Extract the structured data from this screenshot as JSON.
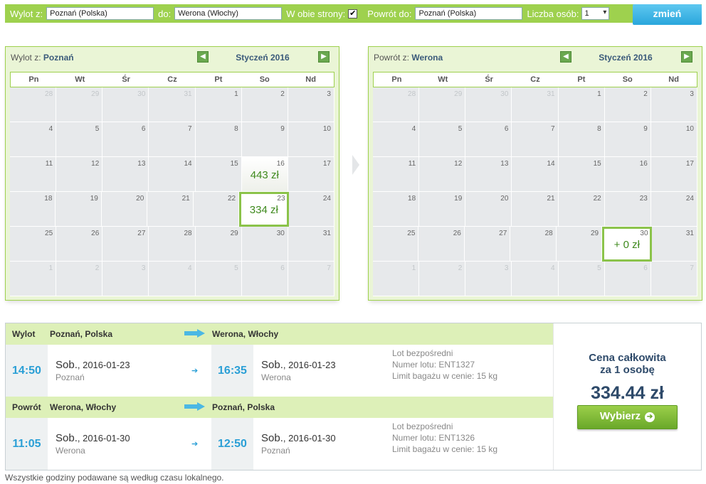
{
  "search": {
    "from_label": "Wylot z:",
    "from_value": "Poznań (Polska)",
    "to_label": "do:",
    "to_value": "Werona (Włochy)",
    "roundtrip_label": "W obie strony:",
    "roundtrip_checked": "✔",
    "return_label": "Powrót do:",
    "return_value": "Poznań (Polska)",
    "persons_label": "Liczba osób:",
    "persons_value": "1",
    "submit_label": "zmień"
  },
  "calendars": [
    {
      "route_prefix": "Wylot z: ",
      "route_city": "Poznań",
      "month": "Styczeń 2016",
      "weekdays": [
        "Pn",
        "Wt",
        "Śr",
        "Cz",
        "Pt",
        "So",
        "Nd"
      ],
      "weeks": [
        [
          {
            "n": "28",
            "o": true
          },
          {
            "n": "29",
            "o": true
          },
          {
            "n": "30",
            "o": true
          },
          {
            "n": "31",
            "o": true
          },
          {
            "n": "1"
          },
          {
            "n": "2"
          },
          {
            "n": "3"
          }
        ],
        [
          {
            "n": "4"
          },
          {
            "n": "5"
          },
          {
            "n": "6"
          },
          {
            "n": "7"
          },
          {
            "n": "8"
          },
          {
            "n": "9"
          },
          {
            "n": "10"
          }
        ],
        [
          {
            "n": "11"
          },
          {
            "n": "12"
          },
          {
            "n": "13"
          },
          {
            "n": "14"
          },
          {
            "n": "15"
          },
          {
            "n": "16",
            "p": "443 zł"
          },
          {
            "n": "17"
          }
        ],
        [
          {
            "n": "18"
          },
          {
            "n": "19"
          },
          {
            "n": "20"
          },
          {
            "n": "21"
          },
          {
            "n": "22"
          },
          {
            "n": "23",
            "p": "334 zł",
            "s": true
          },
          {
            "n": "24"
          }
        ],
        [
          {
            "n": "25"
          },
          {
            "n": "26"
          },
          {
            "n": "27"
          },
          {
            "n": "28"
          },
          {
            "n": "29"
          },
          {
            "n": "30"
          },
          {
            "n": "31"
          }
        ],
        [
          {
            "n": "1",
            "o": true
          },
          {
            "n": "2",
            "o": true
          },
          {
            "n": "3",
            "o": true
          },
          {
            "n": "4",
            "o": true
          },
          {
            "n": "5",
            "o": true
          },
          {
            "n": "6",
            "o": true
          },
          {
            "n": "7",
            "o": true
          }
        ]
      ]
    },
    {
      "route_prefix": "Powrót z: ",
      "route_city": "Werona",
      "month": "Styczeń 2016",
      "weekdays": [
        "Pn",
        "Wt",
        "Śr",
        "Cz",
        "Pt",
        "So",
        "Nd"
      ],
      "weeks": [
        [
          {
            "n": "28",
            "o": true
          },
          {
            "n": "29",
            "o": true
          },
          {
            "n": "30",
            "o": true
          },
          {
            "n": "31",
            "o": true
          },
          {
            "n": "1"
          },
          {
            "n": "2"
          },
          {
            "n": "3"
          }
        ],
        [
          {
            "n": "4"
          },
          {
            "n": "5"
          },
          {
            "n": "6"
          },
          {
            "n": "7"
          },
          {
            "n": "8"
          },
          {
            "n": "9"
          },
          {
            "n": "10"
          }
        ],
        [
          {
            "n": "11"
          },
          {
            "n": "12"
          },
          {
            "n": "13"
          },
          {
            "n": "14"
          },
          {
            "n": "15"
          },
          {
            "n": "16"
          },
          {
            "n": "17"
          }
        ],
        [
          {
            "n": "18"
          },
          {
            "n": "19"
          },
          {
            "n": "20"
          },
          {
            "n": "21"
          },
          {
            "n": "22"
          },
          {
            "n": "23"
          },
          {
            "n": "24"
          }
        ],
        [
          {
            "n": "25"
          },
          {
            "n": "26"
          },
          {
            "n": "27"
          },
          {
            "n": "28"
          },
          {
            "n": "29"
          },
          {
            "n": "30",
            "p": "+ 0 zł",
            "s": true
          },
          {
            "n": "31"
          }
        ],
        [
          {
            "n": "1",
            "o": true
          },
          {
            "n": "2",
            "o": true
          },
          {
            "n": "3",
            "o": true
          },
          {
            "n": "4",
            "o": true
          },
          {
            "n": "5",
            "o": true
          },
          {
            "n": "6",
            "o": true
          },
          {
            "n": "7",
            "o": true
          }
        ]
      ]
    }
  ],
  "legs": [
    {
      "type": "Wylot",
      "from": "Poznań, Polska",
      "to": "Werona, Włochy",
      "dep_time": "14:50",
      "dep_day": "Sob.",
      "dep_date": ", 2016-01-23",
      "dep_city": "Poznań",
      "arr_time": "16:35",
      "arr_day": "Sob.",
      "arr_date": ", 2016-01-23",
      "arr_city": "Werona",
      "info": [
        "Lot bezpośredni",
        "Numer lotu: ENT1327",
        "Limit bagażu w cenie: 15 kg"
      ]
    },
    {
      "type": "Powrót",
      "from": "Werona, Włochy",
      "to": "Poznań, Polska",
      "dep_time": "11:05",
      "dep_day": "Sob.",
      "dep_date": ", 2016-01-30",
      "dep_city": "Werona",
      "arr_time": "12:50",
      "arr_day": "Sob.",
      "arr_date": ", 2016-01-30",
      "arr_city": "Poznań",
      "info": [
        "Lot bezpośredni",
        "Numer lotu: ENT1326",
        "Limit bagażu w cenie: 15 kg"
      ]
    }
  ],
  "price": {
    "label_line1": "Cena całkowita",
    "label_line2": "za 1 osobę",
    "total": "334.44 zł",
    "button": "Wybierz"
  },
  "footnote": "Wszystkie godziny podawane są według czasu lokalnego.",
  "colors": {
    "accent_green": "#9ed14e",
    "price_green": "#3f8a1e",
    "time_blue": "#2a9fd6",
    "button_blue": "#2aa6dc"
  }
}
